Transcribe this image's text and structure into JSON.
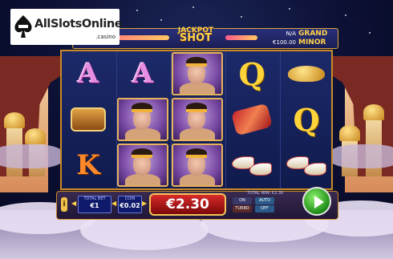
{
  "logo": {
    "text": "AllSlotsOnline",
    "sub": ".casino"
  },
  "jackpot": {
    "title_top": "JACKPOT",
    "title_bottom": "SHOT",
    "grand_amount": "N/A",
    "grand_label": "GRAND",
    "minor_amount": "€100.00",
    "minor_label": "MINOR"
  },
  "reels": [
    [
      "A",
      "chest",
      "K"
    ],
    [
      "A",
      "portrait",
      "portrait"
    ],
    [
      "portrait",
      "portrait",
      "portrait"
    ],
    [
      "Q",
      "scroll",
      "shoes"
    ],
    [
      "lamp",
      "Q",
      "shoes"
    ]
  ],
  "controls": {
    "info_label": "i",
    "total_bet_label": "TOTAL BET",
    "total_bet_value": "€1",
    "coin_label": "COIN",
    "coin_value": "€0.02",
    "win_value": "€2.30",
    "total_win_label": "TOTAL WIN: €2.30",
    "turbo_label": "TURBO",
    "auto_label": "AUTO",
    "off_label": "OFF",
    "on_label": "ON"
  },
  "colors": {
    "win_box": "#b51a1a",
    "spin_button": "#2aa21f",
    "frame_gold": "#c98a26"
  }
}
